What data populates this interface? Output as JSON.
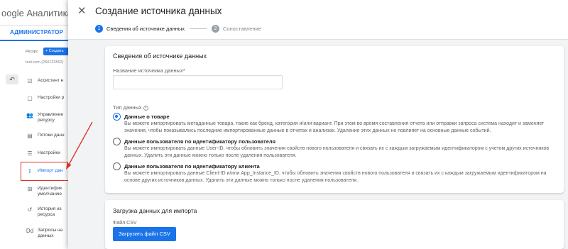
{
  "background": {
    "brand": "oogle Аналитика",
    "tab": "АДМИНИСТРАТОР",
    "resource_label": "Ресурс",
    "create_button": "+ Создать",
    "account_id": "test.com (260123562)",
    "back_icon": "↶",
    "nav": [
      {
        "icon": "check-square-icon",
        "glyph": "☑",
        "label": "Ассистент н"
      },
      {
        "icon": "settings-square-icon",
        "glyph": "▢",
        "label": "Настройки р"
      },
      {
        "icon": "people-icon",
        "glyph": "👥",
        "label": "Управление\nресурсу"
      },
      {
        "icon": "data-streams-icon",
        "glyph": "▤",
        "label": "Потоки данн"
      },
      {
        "icon": "database-icon",
        "glyph": "☰",
        "label": "Настройки"
      },
      {
        "icon": "upload-icon",
        "glyph": "⇪",
        "label": "Импорт дан"
      },
      {
        "icon": "identity-icon",
        "glyph": "⊞",
        "label": "Идентифик\nумолчанию"
      },
      {
        "icon": "history-icon",
        "glyph": "↺",
        "label": "История из\nресурса"
      },
      {
        "icon": "data-deletion-icon",
        "glyph": "Dd",
        "label": "Запросы на\nданных"
      }
    ]
  },
  "panel": {
    "title": "Создание источника данных",
    "steps": [
      {
        "num": "1",
        "label": "Сведения об источнике данных"
      },
      {
        "num": "2",
        "label": "Сопоставление"
      }
    ],
    "card1": {
      "title": "Сведения об источнике данных",
      "name_label": "Название источника данных*",
      "name_value": "",
      "type_label": "Тип данных",
      "options": [
        {
          "title": "Данные о товаре",
          "desc": "Вы можете импортировать метаданные товара, такие как бренд, категория и/или вариант. При этом во время составления отчета или отправки запроса система находит и заменяет значения, чтобы показывались последние импортированные данные в отчетах и анализах. Удаление этих данных не повлияет на основные данные событий.",
          "selected": true
        },
        {
          "title": "Данные пользователя по идентификатору пользователя",
          "desc": "Вы можете импортировать данные User-ID, чтобы обновить значения свойств нового пользователя и связать их с каждым загружаемым идентификатором с учетом других источников данных. Удалить эти данные можно только после удаления пользователя.",
          "selected": false
        },
        {
          "title": "Данные пользователя по идентификатору клиента",
          "desc": "Вы можете импортировать данные Client-ID и/или App_Instance_ID, чтобы обновить значения свойств нового пользователя и связать их с каждым загружаемым идентификатором на основе других источников данных. Удалить эти данные можно только после удаления пользователя.",
          "selected": false
        }
      ]
    },
    "card2": {
      "title": "Загрузка данных для импорта",
      "file_label": "Файл CSV",
      "upload_button": "Загрузить файл CSV"
    }
  },
  "colors": {
    "accent": "#1a73e8",
    "annotation": "#d93025"
  }
}
